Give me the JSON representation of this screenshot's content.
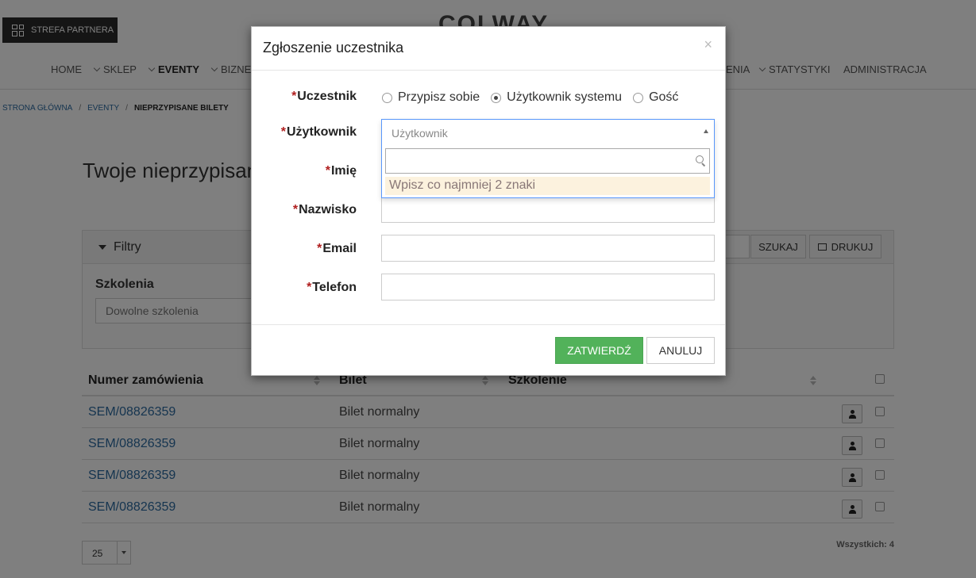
{
  "header": {
    "partner_button": "STREFA PARTNERA",
    "logo": "COLWAY"
  },
  "nav": {
    "items": [
      "HOME",
      "SKLEP",
      "EVENTY",
      "BIZNES",
      "ENIA",
      "STATYSTYKI",
      "ADMINISTRACJA"
    ]
  },
  "breadcrumb": {
    "items": [
      "STRONA GŁÓWNA",
      "EVENTY",
      "NIEPRZYPISANE BILETY"
    ],
    "separator": "/"
  },
  "page": {
    "title": "Twoje nieprzypisan"
  },
  "filters": {
    "heading": "Filtry",
    "trainings_label": "Szkolenia",
    "trainings_placeholder": "Dowolne szkolenia",
    "search_button": "SZUKAJ",
    "print_button": "DRUKUJ"
  },
  "table": {
    "columns": [
      "Numer zamówienia",
      "Bilet",
      "Szkolenie"
    ],
    "rows": [
      {
        "order": "SEM/08826359",
        "ticket": "Bilet normalny",
        "training": ""
      },
      {
        "order": "SEM/08826359",
        "ticket": "Bilet normalny",
        "training": ""
      },
      {
        "order": "SEM/08826359",
        "ticket": "Bilet normalny",
        "training": ""
      },
      {
        "order": "SEM/08826359",
        "ticket": "Bilet normalny",
        "training": ""
      }
    ],
    "per_page": "25",
    "total": "Wszystkich: 4"
  },
  "modal": {
    "title": "Zgłoszenie uczestnika",
    "close": "×",
    "required_mark": "*",
    "labels": {
      "participant": "Uczestnik",
      "user": "Użytkownik",
      "first_name": "Imię",
      "last_name": "Nazwisko",
      "email": "Email",
      "phone": "Telefon"
    },
    "radio_options": [
      "Przypisz sobie",
      "Użytkownik systemu",
      "Gość"
    ],
    "radio_selected": "Użytkownik systemu",
    "user_select": {
      "placeholder": "Użytkownik",
      "search_value": "",
      "message": "Wpisz co najmniej 2 znaki"
    },
    "submit_button": "ZATWIERDŹ",
    "cancel_button": "ANULUJ"
  },
  "colors": {
    "primary_link": "#2c6aa0",
    "success_button": "#52b25a",
    "required": "#b01e1e",
    "overlay": "rgba(0,0,0,0.5)"
  }
}
